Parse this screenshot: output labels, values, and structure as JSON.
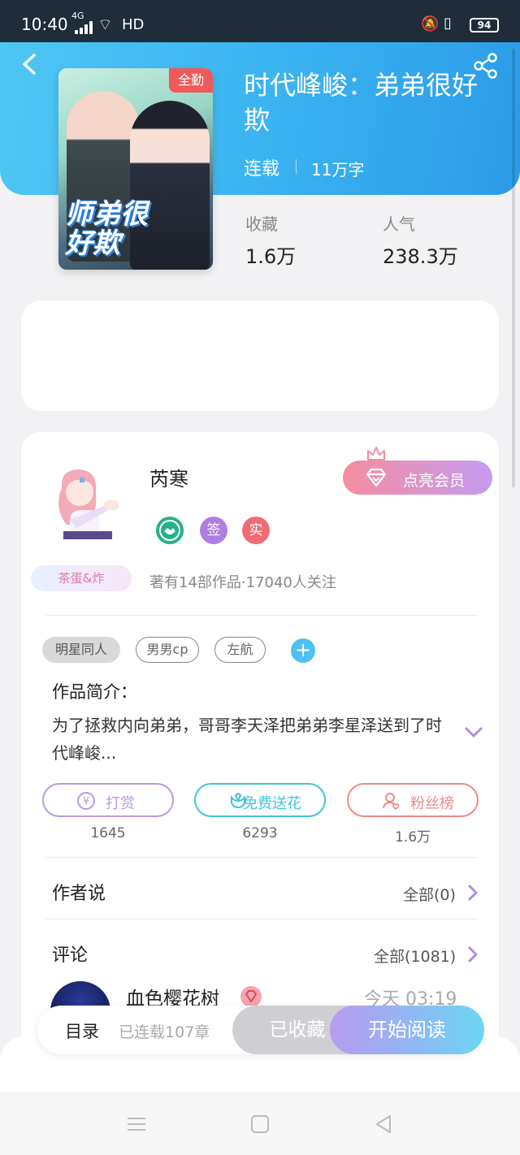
{
  "status_bar": {
    "time": "10:40",
    "network": "4G",
    "hd": "HD",
    "battery": "94"
  },
  "book": {
    "badge": "全勤",
    "cover_title_art": "师弟很好欺",
    "title": "时代峰峻：弟弟很好欺",
    "status": "连载",
    "word_count": "11万字",
    "stats": [
      {
        "label": "收藏",
        "value": "1.6万"
      },
      {
        "label": "人气",
        "value": "238.3万"
      }
    ]
  },
  "author": {
    "name": "芮寒",
    "pill_tag": "茶蛋&炸",
    "badges": [
      {
        "name": "verified-icon",
        "text": "",
        "color": "#27b08a"
      },
      {
        "name": "signed-badge",
        "text": "签",
        "color": "#b07ee0"
      },
      {
        "name": "real-name-badge",
        "text": "实",
        "color": "#f06b74"
      }
    ],
    "meta": "著有14部作品·17040人关注",
    "vip_button": "点亮会员"
  },
  "tags": [
    {
      "label": "明星同人",
      "style": "filled"
    },
    {
      "label": "男男cp",
      "style": "outline"
    },
    {
      "label": "左航",
      "style": "outline"
    }
  ],
  "synopsis": {
    "title": "作品简介：",
    "text": "为了拯救内向弟弟，哥哥李天泽把弟弟李星泽送到了时代峰峻..."
  },
  "actions": [
    {
      "label": "打赏",
      "count": "1645",
      "color": "#b89be6",
      "icon": "coin-icon"
    },
    {
      "label": "免费送花",
      "count": "6293",
      "color": "#43c4dc",
      "icon": "flower-icon"
    },
    {
      "label": "粉丝榜",
      "count": "1.6万",
      "color": "#ef8a8a",
      "icon": "fans-icon"
    }
  ],
  "author_notes": {
    "title": "作者说",
    "more": "全部(0)"
  },
  "comments": {
    "title": "评论",
    "more": "全部(1081)",
    "items": [
      {
        "user": "血色樱花树",
        "time": "今天 03:19"
      }
    ]
  },
  "bottom_bar": {
    "toc": "目录",
    "chapters": "已连载107章",
    "collected": "已收藏",
    "read": "开始阅读"
  },
  "colors": {
    "header": "#3ab2f1",
    "accent_purple": "#b79cf0",
    "accent_blue": "#4fc0f3"
  }
}
